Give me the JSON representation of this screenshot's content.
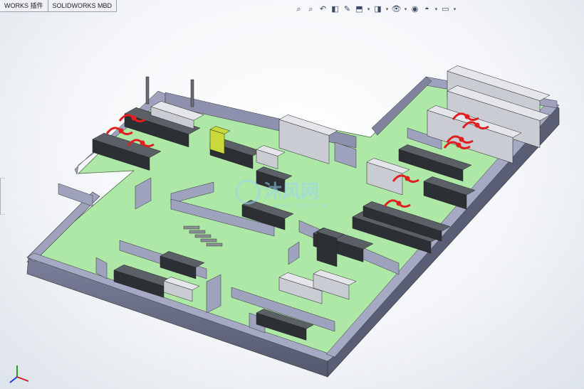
{
  "tabs": [
    {
      "label": "WORKS 插件"
    },
    {
      "label": "SOLIDWORKS MBD"
    }
  ],
  "hud_toolbar": [
    {
      "icon": "zoom-to-fit-icon",
      "glyph": "⌕"
    },
    {
      "icon": "zoom-to-area-icon",
      "glyph": "⌕"
    },
    {
      "icon": "previous-view-icon",
      "glyph": "↶"
    },
    {
      "icon": "section-view-icon",
      "glyph": "◧"
    },
    {
      "icon": "dynamic-annotation-icon",
      "glyph": "✎"
    },
    {
      "icon": "view-orientation-icon",
      "glyph": "⬒",
      "dropdown": true
    },
    {
      "icon": "display-style-icon",
      "glyph": "◨",
      "dropdown": true
    },
    {
      "icon": "hide-show-items-icon",
      "glyph": "👁",
      "dropdown": true
    },
    {
      "icon": "edit-appearance-icon",
      "glyph": "◉"
    },
    {
      "icon": "apply-scene-icon",
      "glyph": "◓",
      "dropdown": true
    },
    {
      "icon": "view-settings-icon",
      "glyph": "▭",
      "dropdown": true
    }
  ],
  "watermark": {
    "text": "沐风网",
    "url": "www.mfcad.com"
  },
  "colors": {
    "floor": "#aee8a6",
    "wall_top": "#9ea2bd",
    "wall_side": "#62667f",
    "cabinet": "#3a3d42",
    "fume_arm": "#e02020",
    "accent": "#c9d93a"
  }
}
